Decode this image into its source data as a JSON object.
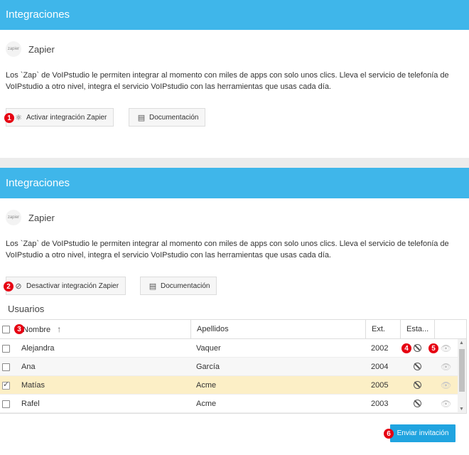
{
  "panel1": {
    "title": "Integraciones",
    "integration_name": "Zapier",
    "logo_text": "zapier",
    "description": "Los `Zap` de VoIPstudio le permiten integrar al momento con miles de apps con solo unos clics. Lleva el servicio de telefonía de VoIPstudio a otro nivel, integra el servicio VoIPstudio con las herramientas que usas cada día.",
    "activate_label": "Activar integración Zapier",
    "docs_label": "Documentación"
  },
  "panel2": {
    "title": "Integraciones",
    "integration_name": "Zapier",
    "logo_text": "zapier",
    "description": "Los `Zap` de VoIPstudio le permiten integrar al momento con miles de apps con solo unos clics. Lleva el servicio de telefonía de VoIPstudio a otro nivel, integra el servicio VoIPstudio con las herramientas que usas cada día.",
    "deactivate_label": "Desactivar integración Zapier",
    "docs_label": "Documentación",
    "users_title": "Usuarios",
    "columns": {
      "nombre": "Nombre",
      "sort_arrow": "↑",
      "apellidos": "Apellidos",
      "ext": "Ext.",
      "estado": "Esta..."
    },
    "users": [
      {
        "nombre": "Alejandra",
        "apellidos": "Vaquer",
        "ext": "2002",
        "checked": false
      },
      {
        "nombre": "Ana",
        "apellidos": "García",
        "ext": "2004",
        "checked": false
      },
      {
        "nombre": "Matías",
        "apellidos": "Acme",
        "ext": "2005",
        "checked": true
      },
      {
        "nombre": "Rafel",
        "apellidos": "Acme",
        "ext": "2003",
        "checked": false
      }
    ],
    "invite_label": "Enviar invitación"
  },
  "markers": [
    "1",
    "2",
    "3",
    "4",
    "5",
    "6"
  ],
  "colors": {
    "header": "#3fb6ea",
    "marker": "#e60012",
    "invite": "#20a4e0",
    "selected_row": "#fcefc6"
  },
  "icons": [
    "zapier-logo",
    "share-icon",
    "book-icon",
    "ban-icon",
    "eye-icon",
    "sort-up-icon"
  ]
}
